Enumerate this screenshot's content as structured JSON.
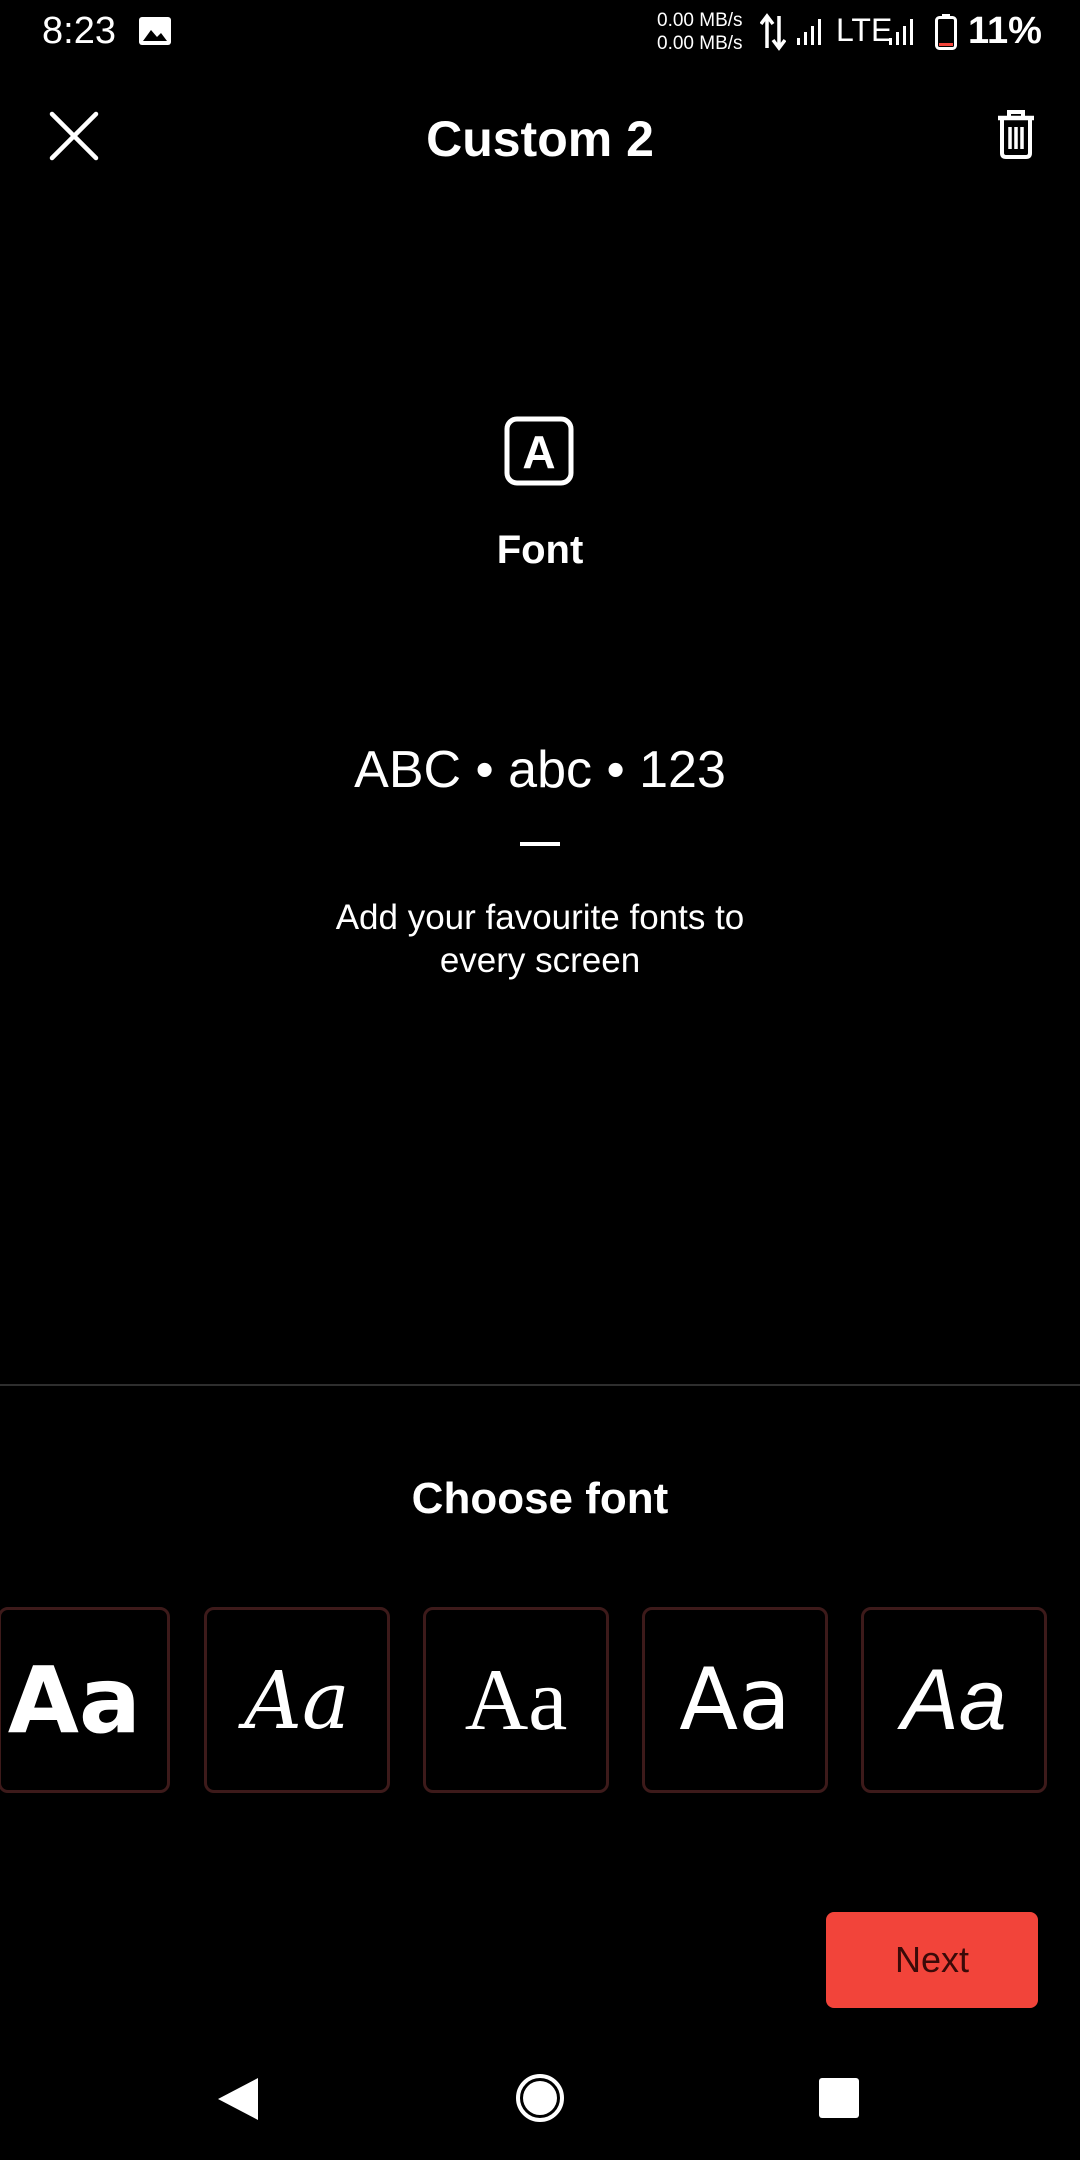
{
  "status_bar": {
    "time": "8:23",
    "rate_up": "0.00 MB/s",
    "rate_down": "0.00 MB/s",
    "network": "LTE",
    "battery": "11%"
  },
  "header": {
    "title": "Custom 2",
    "close_icon": "close-icon",
    "delete_icon": "trash-icon"
  },
  "feature": {
    "icon": "font-icon",
    "icon_glyph": "A",
    "title": "Font",
    "preview": "ABC • abc • 123",
    "description": "Add your favourite fonts to every screen"
  },
  "chooser": {
    "title": "Choose font",
    "options": [
      {
        "label": "Aa"
      },
      {
        "label": "Aa"
      },
      {
        "label": "Aa"
      },
      {
        "label": "Aa"
      },
      {
        "label": "Aa"
      }
    ]
  },
  "actions": {
    "next_label": "Next",
    "accent_color": "#f2443a"
  },
  "nav": {
    "back_icon": "back-triangle-icon",
    "home_icon": "home-circle-icon",
    "recents_icon": "recents-square-icon"
  }
}
